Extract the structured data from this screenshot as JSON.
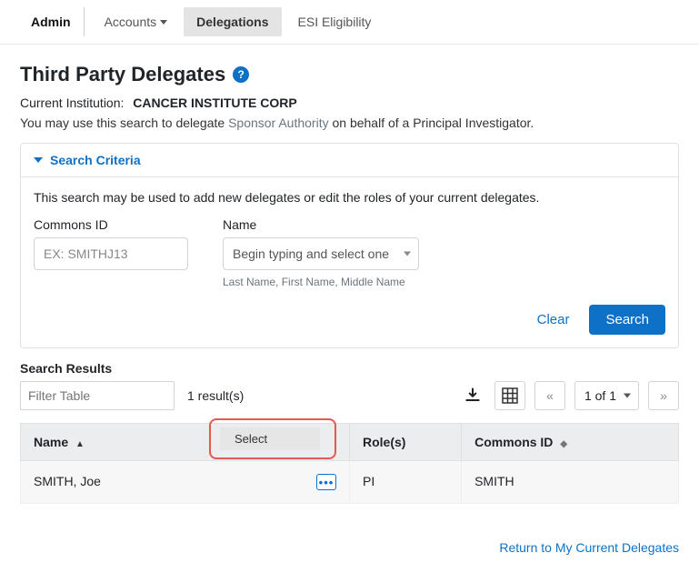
{
  "nav": {
    "admin": "Admin",
    "accounts": "Accounts",
    "delegations": "Delegations",
    "esi": "ESI Eligibility"
  },
  "title": "Third Party Delegates",
  "institution_label": "Current Institution:",
  "institution_name": "CANCER INSTITUTE CORP",
  "hint_pre": "You may use this search to delegate ",
  "hint_link": "Sponsor Authority",
  "hint_post": " on behalf of a Principal Investigator.",
  "panel": {
    "title": "Search Criteria",
    "desc": "This search may be used to add new delegates or edit the roles of your current delegates.",
    "commons_label": "Commons ID",
    "commons_placeholder": "EX: SMITHJ13",
    "name_label": "Name",
    "name_placeholder": "Begin typing and select one",
    "name_hint": "Last Name, First Name, Middle Name",
    "clear": "Clear",
    "search": "Search"
  },
  "results": {
    "heading": "Search Results",
    "filter_placeholder": "Filter Table",
    "count": "1 result(s)",
    "pager": "1 of 1",
    "prev": "«",
    "next": "»",
    "cols": {
      "name": "Name",
      "roles": "Role(s)",
      "commons": "Commons ID"
    },
    "rows": [
      {
        "name": "SMITH, Joe",
        "roles": "PI",
        "commons": "SMITH"
      }
    ],
    "menu_select": "Select"
  },
  "return_link": "Return to My Current Delegates"
}
